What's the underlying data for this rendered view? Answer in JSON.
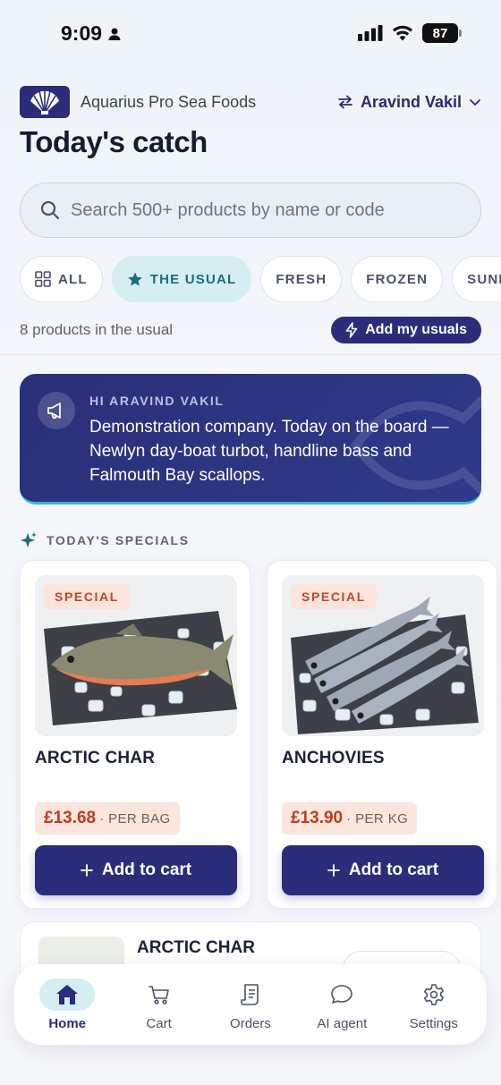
{
  "status_bar": {
    "time": "9:09",
    "battery": "87"
  },
  "brand": {
    "name": "Aquarius Pro Sea Foods"
  },
  "user": {
    "name": "Aravind Vakil"
  },
  "page": {
    "title": "Today's catch"
  },
  "search": {
    "placeholder": "Search 500+ products by name or code"
  },
  "chips": [
    {
      "label": "ALL",
      "icon": "grid-icon",
      "active": false
    },
    {
      "label": "THE USUAL",
      "icon": "star-icon",
      "active": true
    },
    {
      "label": "FRESH",
      "active": false
    },
    {
      "label": "FROZEN",
      "active": false
    },
    {
      "label": "SUNDRY",
      "active": false
    }
  ],
  "usual": {
    "count_text": "8 products in the usual",
    "add_button": "Add my usuals"
  },
  "banner": {
    "greeting": "HI ARAVIND VAKIL",
    "message": "Demonstration company. Today on the board — Newlyn day-boat turbot, handline bass and Falmouth Bay scallops."
  },
  "specials": {
    "section_label": "TODAY'S SPECIALS",
    "items": [
      {
        "badge": "SPECIAL",
        "name": "ARCTIC CHAR",
        "price": "£13.68",
        "unit": "· PER BAG",
        "button": "Add to cart"
      },
      {
        "badge": "SPECIAL",
        "name": "ANCHOVIES",
        "price": "£13.90",
        "unit": "· PER KG",
        "button": "Add to cart"
      }
    ]
  },
  "list": {
    "first_item": "ARCTIC CHAR"
  },
  "tabbar": [
    {
      "label": "Home",
      "icon": "home-icon",
      "active": true
    },
    {
      "label": "Cart",
      "icon": "cart-icon",
      "active": false
    },
    {
      "label": "Orders",
      "icon": "receipt-icon",
      "active": false
    },
    {
      "label": "AI agent",
      "icon": "chat-bubble-icon",
      "active": false
    },
    {
      "label": "Settings",
      "icon": "gear-icon",
      "active": false
    }
  ],
  "colors": {
    "primary": "#2b2d7a",
    "accent_teal": "#d4eef2",
    "special": "#c0462a",
    "price_bg": "#fbe5dc"
  }
}
